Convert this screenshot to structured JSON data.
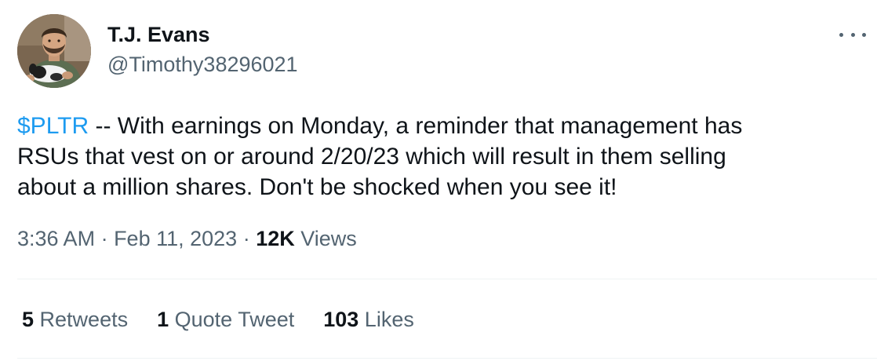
{
  "author": {
    "display_name": "T.J. Evans",
    "handle": "@Timothy38296021",
    "avatar_icon": "profile-photo-person-with-dog"
  },
  "more_icon": "ellipsis-icon",
  "tweet": {
    "cashtag": "$PLTR",
    "line1": " -- With earnings on Monday, a reminder that management has",
    "line2": "RSUs that vest on or around 2/20/23 which will result in them selling",
    "line3": "about a million shares. Don't be shocked when you see it!"
  },
  "meta": {
    "time": "3:36 AM",
    "separator1": " · ",
    "date": "Feb 11, 2023",
    "separator2": " · ",
    "views_count": "12K",
    "views_label": " Views"
  },
  "stats": {
    "retweets_count": "5",
    "retweets_label": " Retweets",
    "quotes_count": "1",
    "quotes_label": " Quote Tweet",
    "likes_count": "103",
    "likes_label": " Likes"
  },
  "colors": {
    "link": "#1d9bf0",
    "primary_text": "#0f1419",
    "secondary_text": "#536471",
    "divider": "#eff3f4"
  }
}
